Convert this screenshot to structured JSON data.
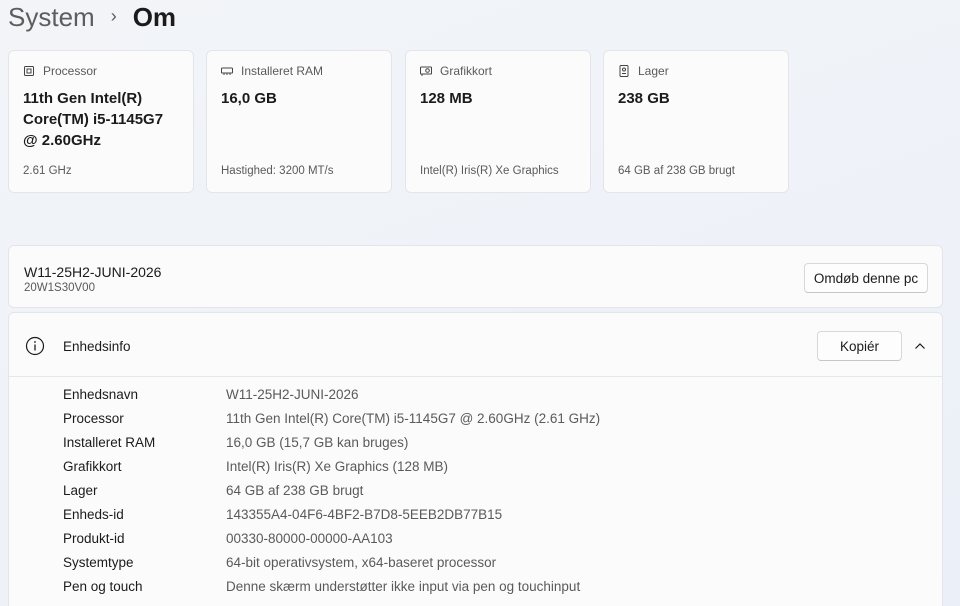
{
  "breadcrumb": {
    "parent": "System",
    "separator": "›",
    "current": "Om"
  },
  "cards": [
    {
      "icon": "processor-icon",
      "title": "Processor",
      "value": "11th Gen Intel(R) Core(TM) i5-1145G7 @ 2.60GHz",
      "sub": "2.61 GHz"
    },
    {
      "icon": "ram-icon",
      "title": "Installeret RAM",
      "value": "16,0 GB",
      "sub": "Hastighed: 3200 MT/s"
    },
    {
      "icon": "graphics-card-icon",
      "title": "Grafikkort",
      "value": "128 MB",
      "sub": "Intel(R) Iris(R) Xe Graphics"
    },
    {
      "icon": "storage-icon",
      "title": "Lager",
      "value": "238 GB",
      "sub": "64 GB af 238 GB brugt"
    }
  ],
  "pc": {
    "name": "W11-25H2-JUNI-2026",
    "model": "20W1S30V00",
    "rename_label": "Omdøb denne pc"
  },
  "device_info": {
    "title": "Enhedsinfo",
    "copy_label": "Kopiér",
    "rows": [
      {
        "label": "Enhedsnavn",
        "value": "W11-25H2-JUNI-2026"
      },
      {
        "label": "Processor",
        "value": "11th Gen Intel(R) Core(TM) i5-1145G7 @ 2.60GHz (2.61 GHz)"
      },
      {
        "label": "Installeret RAM",
        "value": "16,0 GB (15,7 GB kan bruges)"
      },
      {
        "label": "Grafikkort",
        "value": "Intel(R) Iris(R) Xe Graphics (128 MB)"
      },
      {
        "label": "Lager",
        "value": "64 GB af 238 GB brugt"
      },
      {
        "label": "Enheds-id",
        "value": "143355A4-04F6-4BF2-B7D8-5EEB2DB77B15"
      },
      {
        "label": "Produkt-id",
        "value": "00330-80000-00000-AA103"
      },
      {
        "label": "Systemtype",
        "value": "64-bit operativsystem, x64-baseret processor"
      },
      {
        "label": "Pen og touch",
        "value": "Denne skærm understøtter ikke input via pen og touchinput"
      }
    ]
  }
}
